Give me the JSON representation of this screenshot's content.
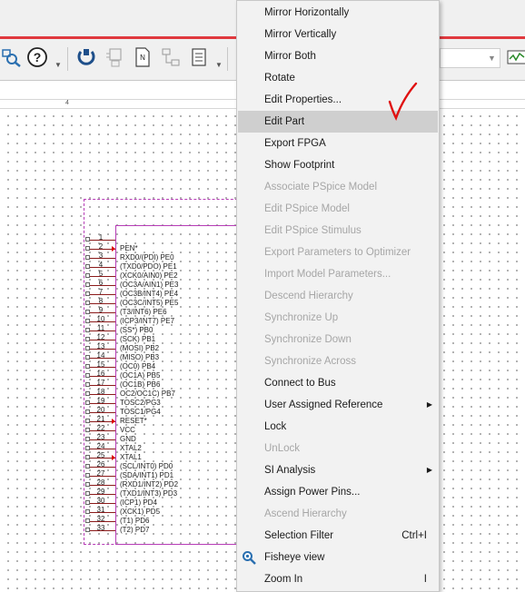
{
  "toolbar": {
    "buttons": [
      {
        "name": "zoom-area-icon"
      },
      {
        "name": "help-icon",
        "glyph": "?"
      },
      {
        "name": "refresh-icon"
      },
      {
        "name": "part-icon"
      },
      {
        "name": "netlist-icon"
      },
      {
        "name": "annotate-icon"
      },
      {
        "name": "bom-icon"
      },
      {
        "name": "simulation-icon"
      }
    ]
  },
  "ruler": {
    "label": "4"
  },
  "part": {
    "pins": [
      {
        "num": "1",
        "label": ""
      },
      {
        "num": "2",
        "label": "PEN*",
        "arrow": true
      },
      {
        "num": "3",
        "label": "RXD0/(PDI) PE0"
      },
      {
        "num": "4",
        "label": "(TXD0/PDO) PE1"
      },
      {
        "num": "5",
        "label": "(XCK0/AIN0) PE2"
      },
      {
        "num": "6",
        "label": "(OC3A/AIN1) PE3"
      },
      {
        "num": "7",
        "label": "(OC3B/INT4) PE4"
      },
      {
        "num": "8",
        "label": "(OC3C/INT5) PE5"
      },
      {
        "num": "9",
        "label": "(T3/INT6) PE6"
      },
      {
        "num": "10",
        "label": "(ICP3/INT7) PE7"
      },
      {
        "num": "11",
        "label": "(SS*) PB0"
      },
      {
        "num": "12",
        "label": "(SCK) PB1"
      },
      {
        "num": "13",
        "label": "(MOSI) PB2"
      },
      {
        "num": "14",
        "label": "(MISO) PB3"
      },
      {
        "num": "15",
        "label": "(OC0) PB4"
      },
      {
        "num": "16",
        "label": "(OC1A) PB5"
      },
      {
        "num": "17",
        "label": "(OC1B) PB6"
      },
      {
        "num": "18",
        "label": "OC2/OC1C) PB7"
      },
      {
        "num": "19",
        "label": "TOSC2/PG3"
      },
      {
        "num": "20",
        "label": "TOSC1/PG4"
      },
      {
        "num": "21",
        "label": "RESET*",
        "arrow": true
      },
      {
        "num": "22",
        "label": "VCC"
      },
      {
        "num": "23",
        "label": "GND"
      },
      {
        "num": "24",
        "label": "XTAL2"
      },
      {
        "num": "25",
        "label": "XTAL1",
        "arrow": true
      },
      {
        "num": "26",
        "label": "(SCL/INT0) PD0"
      },
      {
        "num": "27",
        "label": "(SDA/INT1) PD1"
      },
      {
        "num": "28",
        "label": "(RXD1/INT2) PD2"
      },
      {
        "num": "29",
        "label": "(TXD1/INT3) PD3"
      },
      {
        "num": "30",
        "label": "(ICP1) PD4"
      },
      {
        "num": "31",
        "label": "(XCK1) PD5"
      },
      {
        "num": "32",
        "label": "(T1) PD6"
      },
      {
        "num": "33",
        "label": "(T2) PD7"
      }
    ]
  },
  "context_menu": {
    "items": [
      {
        "label": "Mirror Horizontally",
        "enabled": true
      },
      {
        "label": "Mirror Vertically",
        "enabled": true
      },
      {
        "label": "Mirror Both",
        "enabled": true
      },
      {
        "label": "Rotate",
        "enabled": true
      },
      {
        "label": "Edit Properties...",
        "enabled": true
      },
      {
        "label": "Edit Part",
        "enabled": true,
        "highlighted": true
      },
      {
        "label": "Export FPGA",
        "enabled": true
      },
      {
        "label": "Show Footprint",
        "enabled": true
      },
      {
        "label": "Associate PSpice Model",
        "enabled": false
      },
      {
        "label": "Edit PSpice Model",
        "enabled": false
      },
      {
        "label": "Edit PSpice Stimulus",
        "enabled": false
      },
      {
        "label": "Export Parameters to Optimizer",
        "enabled": false
      },
      {
        "label": "Import Model Parameters...",
        "enabled": false
      },
      {
        "label": "Descend Hierarchy",
        "enabled": false
      },
      {
        "label": "Synchronize Up",
        "enabled": false
      },
      {
        "label": "Synchronize Down",
        "enabled": false
      },
      {
        "label": "Synchronize Across",
        "enabled": false
      },
      {
        "label": "Connect to Bus",
        "enabled": true
      },
      {
        "label": "User Assigned Reference",
        "enabled": true,
        "submenu": true
      },
      {
        "label": "Lock",
        "enabled": true
      },
      {
        "label": "UnLock",
        "enabled": false
      },
      {
        "label": "SI Analysis",
        "enabled": true,
        "submenu": true
      },
      {
        "label": "Assign Power Pins...",
        "enabled": true
      },
      {
        "label": "Ascend Hierarchy",
        "enabled": false
      },
      {
        "label": "Selection Filter",
        "enabled": true,
        "shortcut": "Ctrl+I"
      },
      {
        "label": "Fisheye view",
        "enabled": true,
        "icon": "fisheye-icon"
      },
      {
        "label": "Zoom In",
        "enabled": true,
        "shortcut": "I"
      }
    ]
  },
  "colors": {
    "accent_red": "#e0393e",
    "part_outline": "#b63cb6",
    "highlight": "#cfcfcf"
  }
}
